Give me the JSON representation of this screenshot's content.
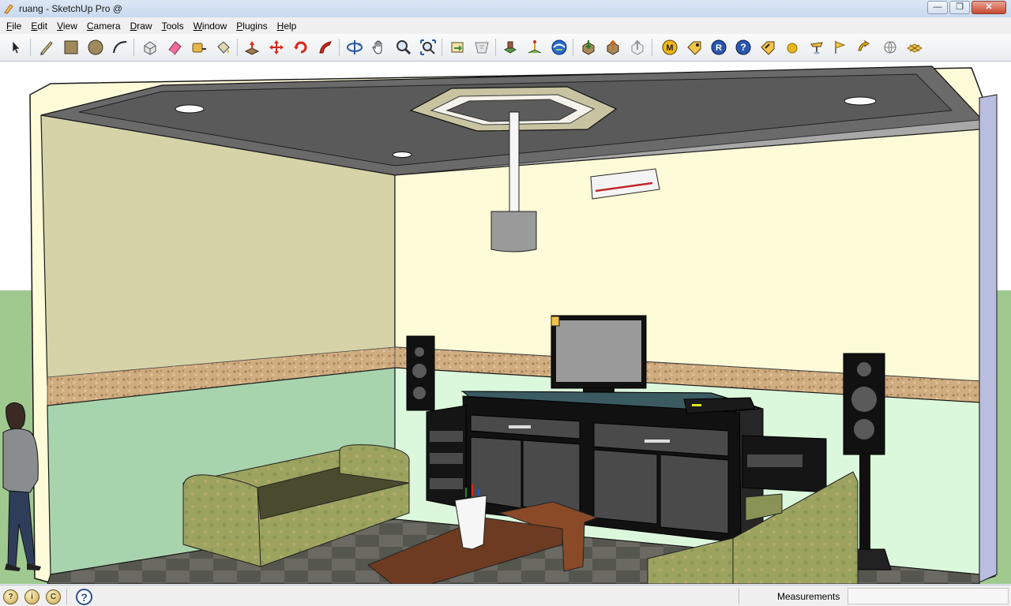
{
  "window": {
    "title": "ruang - SketchUp Pro @"
  },
  "menu": {
    "items": [
      {
        "label": "File",
        "underline": "F"
      },
      {
        "label": "Edit",
        "underline": "E"
      },
      {
        "label": "View",
        "underline": "V"
      },
      {
        "label": "Camera",
        "underline": "C"
      },
      {
        "label": "Draw",
        "underline": "D"
      },
      {
        "label": "Tools",
        "underline": "T"
      },
      {
        "label": "Window",
        "underline": "W"
      },
      {
        "label": "Plugins",
        "underline": "P"
      },
      {
        "label": "Help",
        "underline": "H"
      }
    ]
  },
  "toolbar": {
    "tools": [
      {
        "name": "select-tool-icon"
      },
      {
        "name": "pencil-line-tool-icon"
      },
      {
        "name": "rectangle-tool-icon"
      },
      {
        "name": "circle-tool-icon"
      },
      {
        "name": "arc-tool-icon"
      },
      {
        "name": "make-component-tool-icon"
      },
      {
        "name": "eraser-tool-icon"
      },
      {
        "name": "tape-measure-tool-icon"
      },
      {
        "name": "paint-bucket-tool-icon"
      },
      {
        "name": "push-pull-tool-icon"
      },
      {
        "name": "move-tool-icon"
      },
      {
        "name": "rotate-tool-icon"
      },
      {
        "name": "follow-me-tool-icon"
      },
      {
        "name": "orbit-tool-icon"
      },
      {
        "name": "pan-tool-icon"
      },
      {
        "name": "zoom-tool-icon"
      },
      {
        "name": "zoom-extents-tool-icon"
      },
      {
        "name": "previous-view-icon"
      },
      {
        "name": "next-view-icon"
      },
      {
        "name": "add-location-icon"
      },
      {
        "name": "toggle-terrain-icon"
      },
      {
        "name": "google-earth-icon"
      },
      {
        "name": "get-models-icon"
      },
      {
        "name": "share-model-icon"
      },
      {
        "name": "share-component-icon"
      },
      {
        "name": "extension-m-icon"
      },
      {
        "name": "extension-tag-icon"
      },
      {
        "name": "extension-r-icon"
      },
      {
        "name": "extension-help-icon"
      },
      {
        "name": "extension-label-icon"
      },
      {
        "name": "sphere-icon"
      },
      {
        "name": "lamp-icon"
      },
      {
        "name": "flag-icon"
      },
      {
        "name": "gold-arrow-icon"
      },
      {
        "name": "globe-outline-icon"
      },
      {
        "name": "plane-icon"
      }
    ]
  },
  "statusbar": {
    "icons": [
      "geo-location-icon",
      "credits-icon",
      "copyright-icon"
    ],
    "help": "?",
    "measurements_label": "Measurements",
    "measurements_value": ""
  },
  "colors": {
    "sky": "#ffffff",
    "ground": "#9fc98f",
    "ceiling": "#666666",
    "left_wall_upper": "#d6d3a8",
    "left_wall_lower": "#a8d4ad",
    "back_wall_upper": "#fdfbd8",
    "back_wall_lower": "#dcf8dc",
    "border_strip": "#c9a57a",
    "floor": "#5a5a50",
    "sofa": "#9aa05e",
    "tv_cabinet": "#1a1a1a",
    "coffee_table": "#6d3a22"
  }
}
